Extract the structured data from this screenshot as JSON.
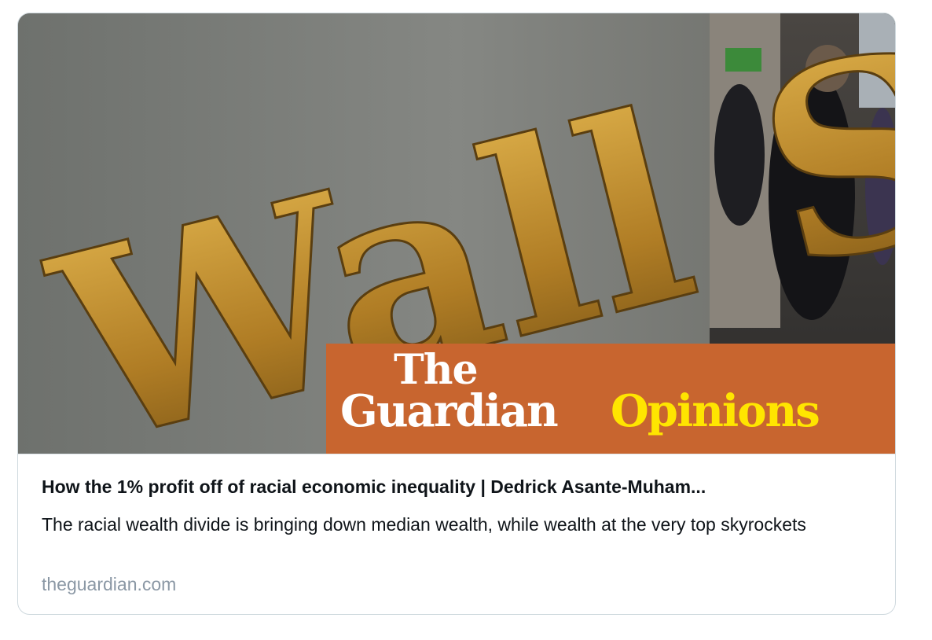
{
  "card": {
    "image": {
      "engraving_text": "Wall Street",
      "banner": {
        "the": "The",
        "guardian": "Guardian",
        "opinions": "Opinions"
      }
    },
    "title": "How the 1% profit off of racial economic inequality | Dedrick Asante-Muham...",
    "description": "The racial wealth divide is bringing down median wealth, while wealth at the very top skyrockets",
    "domain": "theguardian.com"
  },
  "colors": {
    "banner": "#c8652f",
    "opinions": "#ffe500",
    "gold": "#c99a3a",
    "domain": "#8b98a5"
  },
  "icons": []
}
